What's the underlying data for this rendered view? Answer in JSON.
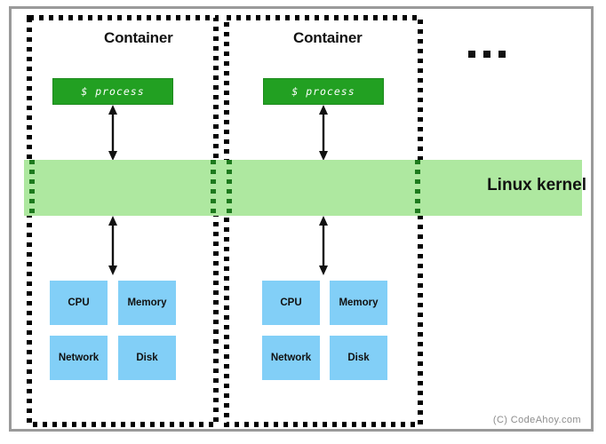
{
  "diagram": {
    "title_hidden": "",
    "kernel": {
      "label": "Linux kernel",
      "band_color": "#aee8a0"
    },
    "ellipsis": {
      "name": "more-containers-ellipsis",
      "dots": 3
    },
    "watermark": "(C) CodeAhoy.com",
    "colors": {
      "frame_border": "#9a9a9a",
      "container_border": "#000000",
      "process_fill": "#22a022",
      "process_text": "#ffffff",
      "resource_fill": "#82cff7",
      "kernel_fill": "#aee8a0",
      "text": "#111111",
      "watermark_text": "#8d8d8d"
    },
    "containers": [
      {
        "title": "Container",
        "process": {
          "label": "$ process"
        },
        "resources": [
          {
            "label": "CPU"
          },
          {
            "label": "Memory"
          },
          {
            "label": "Network"
          },
          {
            "label": "Disk"
          }
        ],
        "arrows": [
          {
            "name": "process-to-kernel-arrow",
            "direction": "bidirectional"
          },
          {
            "name": "kernel-to-resources-arrow",
            "direction": "bidirectional"
          }
        ]
      },
      {
        "title": "Container",
        "process": {
          "label": "$ process"
        },
        "resources": [
          {
            "label": "CPU"
          },
          {
            "label": "Memory"
          },
          {
            "label": "Network"
          },
          {
            "label": "Disk"
          }
        ],
        "arrows": [
          {
            "name": "process-to-kernel-arrow",
            "direction": "bidirectional"
          },
          {
            "name": "kernel-to-resources-arrow",
            "direction": "bidirectional"
          }
        ]
      }
    ]
  }
}
